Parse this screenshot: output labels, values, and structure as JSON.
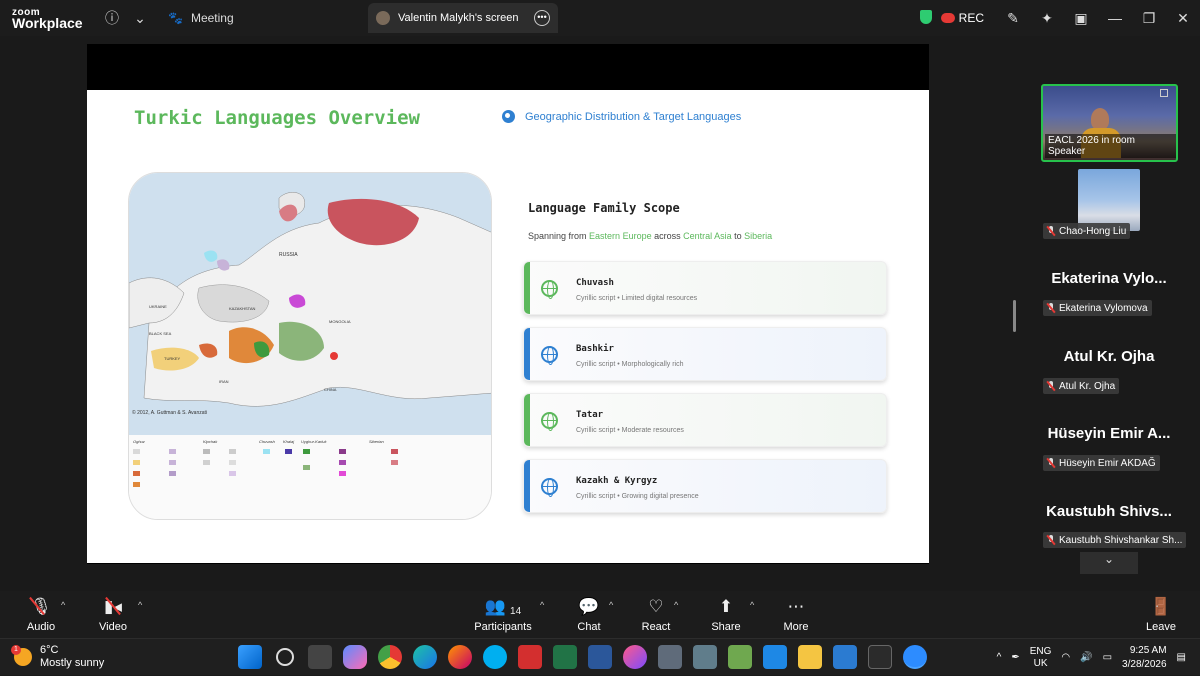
{
  "topbar": {
    "logo_line1": "zoom",
    "logo_line2": "Workplace",
    "meeting_label": "Meeting",
    "screen_tab_label": "Valentin Malykh's screen",
    "rec_label": "REC"
  },
  "slide": {
    "title": "Turkic Languages Overview",
    "subtitle": "Geographic Distribution & Target Languages",
    "map_caption": "© 2012, A. Guttman & S. Avanzati",
    "scope_title": "Language Family Scope",
    "scope_sub_pre": "Spanning from ",
    "scope_sub_r1": "Eastern Europe",
    "scope_sub_mid1": " across ",
    "scope_sub_r2": "Central Asia",
    "scope_sub_mid2": " to ",
    "scope_sub_r3": "Siberia",
    "legend_headers": [
      "Oghuz",
      "Kipchak",
      "Chuvash",
      "Khalaj",
      "Uyghur-Karluk",
      "Siberian"
    ],
    "cards": [
      {
        "name": "Chuvash",
        "desc": "Cyrillic script • Limited digital resources",
        "accent": "#5cb85c"
      },
      {
        "name": "Bashkir",
        "desc": "Cyrillic script • Morphologically rich",
        "accent": "#2f80d1"
      },
      {
        "name": "Tatar",
        "desc": "Cyrillic script • Moderate resources",
        "accent": "#5cb85c"
      },
      {
        "name": "Kazakh & Kyrgyz",
        "desc": "Cyrillic script • Growing digital presence",
        "accent": "#2f80d1"
      }
    ]
  },
  "participants": {
    "speaker_label": "EACL 2026 in room Speaker",
    "list": [
      {
        "display": "",
        "tag": "Chao-Hong Liu"
      },
      {
        "display": "Ekaterina Vylo...",
        "tag": "Ekaterina Vylomova"
      },
      {
        "display": "Atul Kr. Ojha",
        "tag": "Atul Kr. Ojha"
      },
      {
        "display": "Hüseyin Emir A...",
        "tag": "Hüseyin Emir AKDAĞ"
      },
      {
        "display": "Kaustubh Shivs...",
        "tag": "Kaustubh Shivshankar Sh..."
      }
    ]
  },
  "toolbar": {
    "audio": "Audio",
    "video": "Video",
    "participants": "Participants",
    "participants_count": "14",
    "chat": "Chat",
    "react": "React",
    "share": "Share",
    "more": "More",
    "leave": "Leave"
  },
  "taskbar": {
    "weather_badge": "1",
    "temperature": "6°C",
    "weather": "Mostly sunny",
    "lang1": "ENG",
    "lang2": "UK",
    "time": "9:25 AM",
    "date": "3/28/2026"
  }
}
